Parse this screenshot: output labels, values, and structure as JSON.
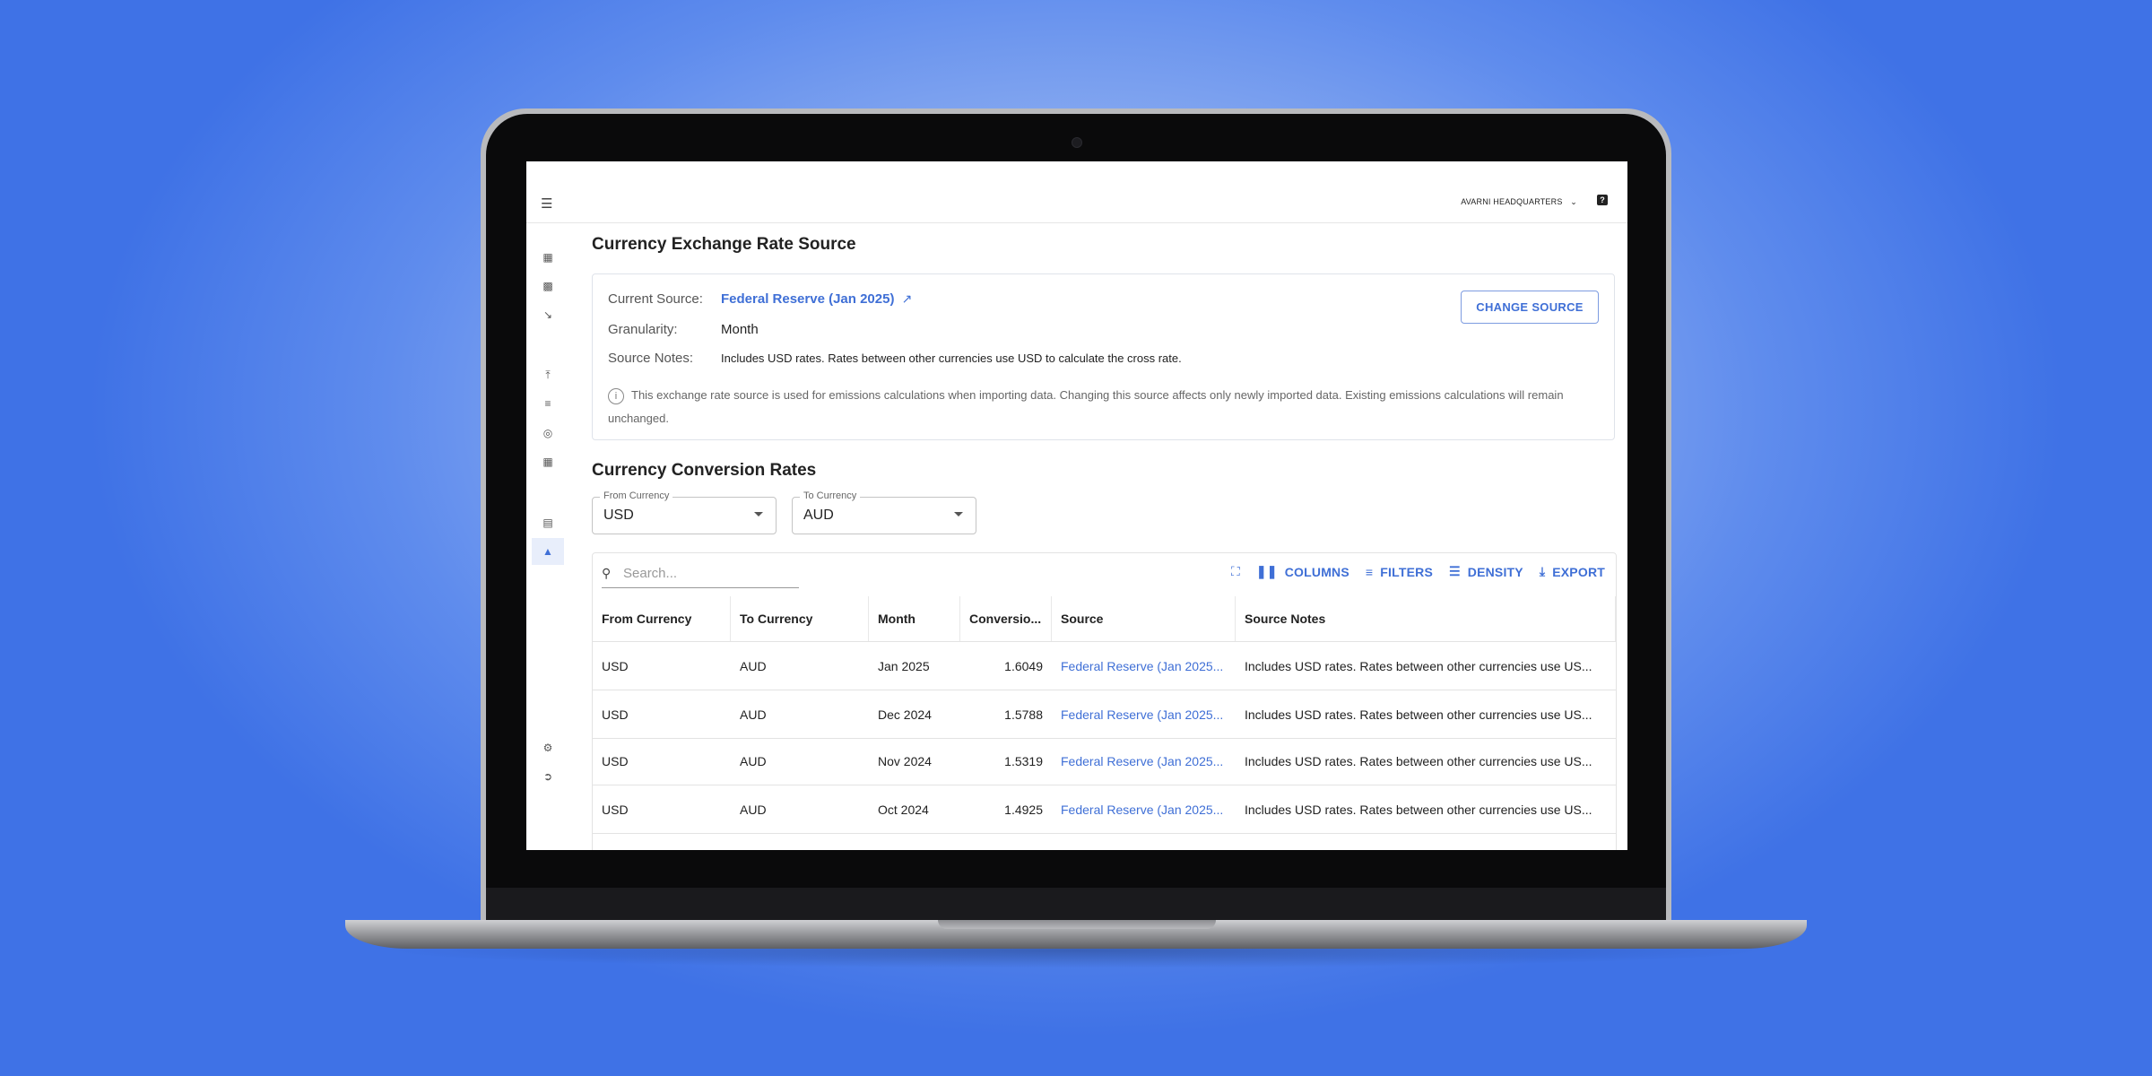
{
  "header": {
    "org_name": "AVARNI HEADQUARTERS",
    "menu_icon": "menu-icon",
    "help_icon": "help-icon"
  },
  "sidebar": {
    "items": [
      {
        "icon": "dashboard-icon"
      },
      {
        "icon": "chart-icon"
      },
      {
        "icon": "trend-icon"
      },
      {
        "icon": "upload-icon"
      },
      {
        "icon": "list-icon"
      },
      {
        "icon": "target-icon"
      },
      {
        "icon": "table-icon"
      },
      {
        "icon": "clipboard-icon"
      },
      {
        "icon": "flask-icon",
        "active": true
      },
      {
        "icon": "settings-icon"
      },
      {
        "icon": "logout-icon"
      }
    ]
  },
  "source_section": {
    "title": "Currency Exchange Rate Source",
    "current_source_label": "Current Source:",
    "current_source_value": "Federal Reserve (Jan 2025)",
    "granularity_label": "Granularity:",
    "granularity_value": "Month",
    "notes_label": "Source Notes:",
    "notes_value": "Includes USD rates. Rates between other currencies use USD to calculate the cross rate.",
    "change_button": "CHANGE SOURCE",
    "info_text": "This exchange rate source is used for emissions calculations when importing data. Changing this source affects only newly imported data. Existing emissions calculations will remain unchanged."
  },
  "conversion_section": {
    "title": "Currency Conversion Rates",
    "from_select": {
      "label": "From Currency",
      "value": "USD"
    },
    "to_select": {
      "label": "To Currency",
      "value": "AUD"
    },
    "search_placeholder": "Search...",
    "toolbar": {
      "columns": "COLUMNS",
      "filters": "FILTERS",
      "density": "DENSITY",
      "export": "EXPORT"
    },
    "columns": [
      "From Currency",
      "To Currency",
      "Month",
      "Conversio...",
      "Source",
      "Source Notes"
    ],
    "rows": [
      [
        "USD",
        "AUD",
        "Jan 2025",
        "1.6049",
        "Federal Reserve (Jan 2025...",
        "Includes USD rates. Rates between other currencies use US..."
      ],
      [
        "USD",
        "AUD",
        "Dec 2024",
        "1.5788",
        "Federal Reserve (Jan 2025...",
        "Includes USD rates. Rates between other currencies use US..."
      ],
      [
        "USD",
        "AUD",
        "Nov 2024",
        "1.5319",
        "Federal Reserve (Jan 2025...",
        "Includes USD rates. Rates between other currencies use US..."
      ],
      [
        "USD",
        "AUD",
        "Oct 2024",
        "1.4925",
        "Federal Reserve (Jan 2025...",
        "Includes USD rates. Rates between other currencies use US..."
      ]
    ]
  },
  "colors": {
    "accent": "#3f6fd6",
    "background_gradient_center": "#b8cdf6",
    "background_gradient_edge": "#3f72e6"
  }
}
